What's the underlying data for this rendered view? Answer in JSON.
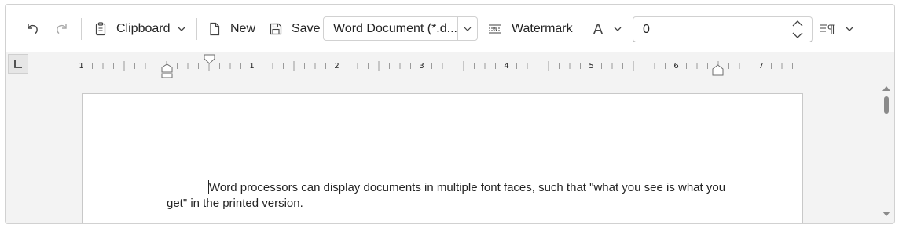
{
  "toolbar": {
    "undo_icon": "undo-icon",
    "redo_icon": "redo-icon",
    "clipboard_label": "Clipboard",
    "new_label": "New",
    "save_label": "Save",
    "format_select_value": "Word Document (*.d...",
    "watermark_label": "Watermark",
    "font_icon_label": "A",
    "spin_value": "0"
  },
  "ruler": {
    "numbers": [
      "1",
      "1",
      "2",
      "3",
      "4",
      "5",
      "6",
      "7"
    ]
  },
  "document": {
    "paragraph": "Word processors can display documents in multiple font faces, such that \"what you see is what you get\" in the printed version."
  },
  "colors": {
    "frame_bg": "#f3f3f3",
    "toolbar_bg": "#ffffff",
    "text": "#242424",
    "border": "#d1d1d1"
  }
}
